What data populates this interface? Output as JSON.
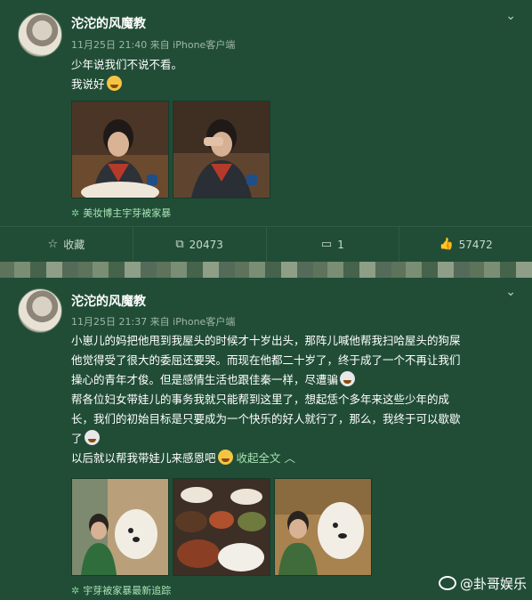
{
  "posts": [
    {
      "author": "沱沱的风魔教",
      "meta": "11月25日 21:40 来自 iPhone客户端",
      "lines": [
        "少年说我们不说不看。",
        "我说好"
      ],
      "tag": "美妆博主宇芽被家暴",
      "actions": {
        "collect": "收藏",
        "repost": "20473",
        "comment": "1",
        "like": "57472"
      }
    },
    {
      "author": "沱沱的风魔教",
      "meta": "11月25日 21:37 来自 iPhone客户端",
      "lines": [
        "小崽儿的妈把他甩到我屋头的时候才十岁出头，那阵儿喊他帮我扫哈屋头的狗屎",
        "他觉得受了很大的委屈还要哭。而现在他都二十岁了，终于成了一个不再让我们",
        "操心的青年才俊。但是感情生活也跟佳秦一样，尽遭骗",
        "帮各位妇女带娃儿的事务我就只能帮到这里了，想起恁个多年来这些少年的成",
        "长，我们的初始目标是只要成为一个快乐的好人就行了，那么，我终于可以歇歇",
        "了",
        "以后就以帮我带娃儿来感恩吧"
      ],
      "collapse": "收起全文",
      "tag": "宇芽被家暴最新追踪"
    }
  ],
  "watermark": "卦哥娱乐"
}
